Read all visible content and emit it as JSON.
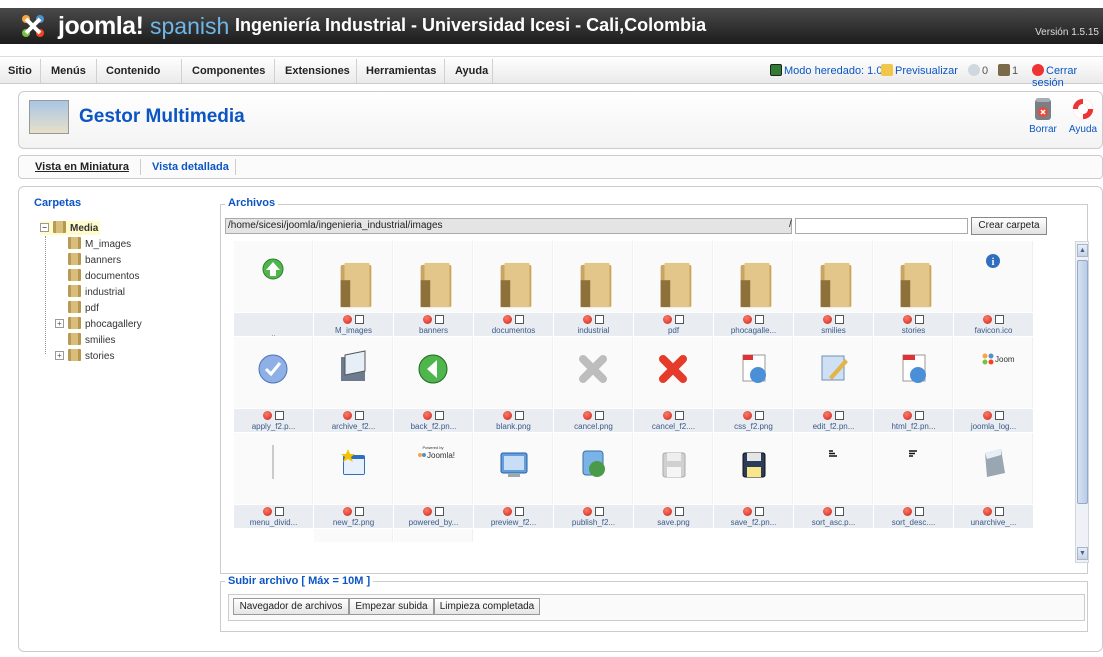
{
  "header": {
    "brand": "joomla!",
    "brand_sub": "spanish",
    "site_title": "Ingeniería Industrial - Universidad Icesi - Cali,Colombia",
    "version": "Versión 1.5.15"
  },
  "menu": {
    "items": [
      "Sitio",
      "Menús",
      "Contenido",
      "Componentes",
      "Extensiones",
      "Herramientas",
      "Ayuda"
    ],
    "status": {
      "legacy": "Modo heredado: 1.0",
      "preview": "Previsualizar",
      "messages": "0",
      "users": "1",
      "logout": "Cerrar sesión"
    }
  },
  "toolbar": {
    "title": "Gestor Multimedia",
    "delete_label": "Borrar",
    "help_label": "Ayuda"
  },
  "tabs": [
    "Vista en Miniatura",
    "Vista detallada"
  ],
  "folders": {
    "title": "Carpetas",
    "root": "Media",
    "children": [
      "M_images",
      "banners",
      "documentos",
      "industrial",
      "pdf",
      "phocagallery",
      "smilies",
      "stories"
    ]
  },
  "files": {
    "title": "Archivos",
    "path": "/home/sicesi/joomla/ingenieria_industrial/images",
    "slash": "/",
    "create_folder": "Crear carpeta",
    "items": [
      {
        "name": "..",
        "kind": "up-icon"
      },
      {
        "name": "M_images",
        "kind": "folder-icon"
      },
      {
        "name": "banners",
        "kind": "folder-icon"
      },
      {
        "name": "documentos",
        "kind": "folder-icon"
      },
      {
        "name": "industrial",
        "kind": "folder-icon"
      },
      {
        "name": "pdf",
        "kind": "folder-icon"
      },
      {
        "name": "phocagalle...",
        "kind": "folder-icon"
      },
      {
        "name": "smilies",
        "kind": "folder-icon"
      },
      {
        "name": "stories",
        "kind": "folder-icon"
      },
      {
        "name": "favicon.ico",
        "kind": "info-icon"
      },
      {
        "name": "apply_f2.p...",
        "kind": "apply-icon"
      },
      {
        "name": "archive_f2...",
        "kind": "archive-icon"
      },
      {
        "name": "back_f2.pn...",
        "kind": "back-icon"
      },
      {
        "name": "blank.png",
        "kind": "blank-icon"
      },
      {
        "name": "cancel.png",
        "kind": "cancel-gray-icon"
      },
      {
        "name": "cancel_f2....",
        "kind": "cancel-red-icon"
      },
      {
        "name": "css_f2.png",
        "kind": "css-icon"
      },
      {
        "name": "edit_f2.pn...",
        "kind": "edit-icon"
      },
      {
        "name": "html_f2.pn...",
        "kind": "html-icon"
      },
      {
        "name": "joomla_log...",
        "kind": "joomla-logo-icon"
      },
      {
        "name": "menu_divid...",
        "kind": "divider-icon"
      },
      {
        "name": "new_f2.png",
        "kind": "new-icon"
      },
      {
        "name": "powered_by...",
        "kind": "powered-icon"
      },
      {
        "name": "preview_f2...",
        "kind": "preview-icon"
      },
      {
        "name": "publish_f2...",
        "kind": "publish-icon"
      },
      {
        "name": "save.png",
        "kind": "save-gray-icon"
      },
      {
        "name": "save_f2.pn...",
        "kind": "save-icon"
      },
      {
        "name": "sort_asc.p...",
        "kind": "sort-asc-icon"
      },
      {
        "name": "sort_desc....",
        "kind": "sort-desc-icon"
      },
      {
        "name": "unarchive_...",
        "kind": "unarchive-icon"
      }
    ]
  },
  "upload": {
    "title": "Subir archivo [ Máx = 10M ]",
    "browse": "Navegador de archivos",
    "start": "Empezar subida",
    "clear": "Limpieza completada"
  }
}
